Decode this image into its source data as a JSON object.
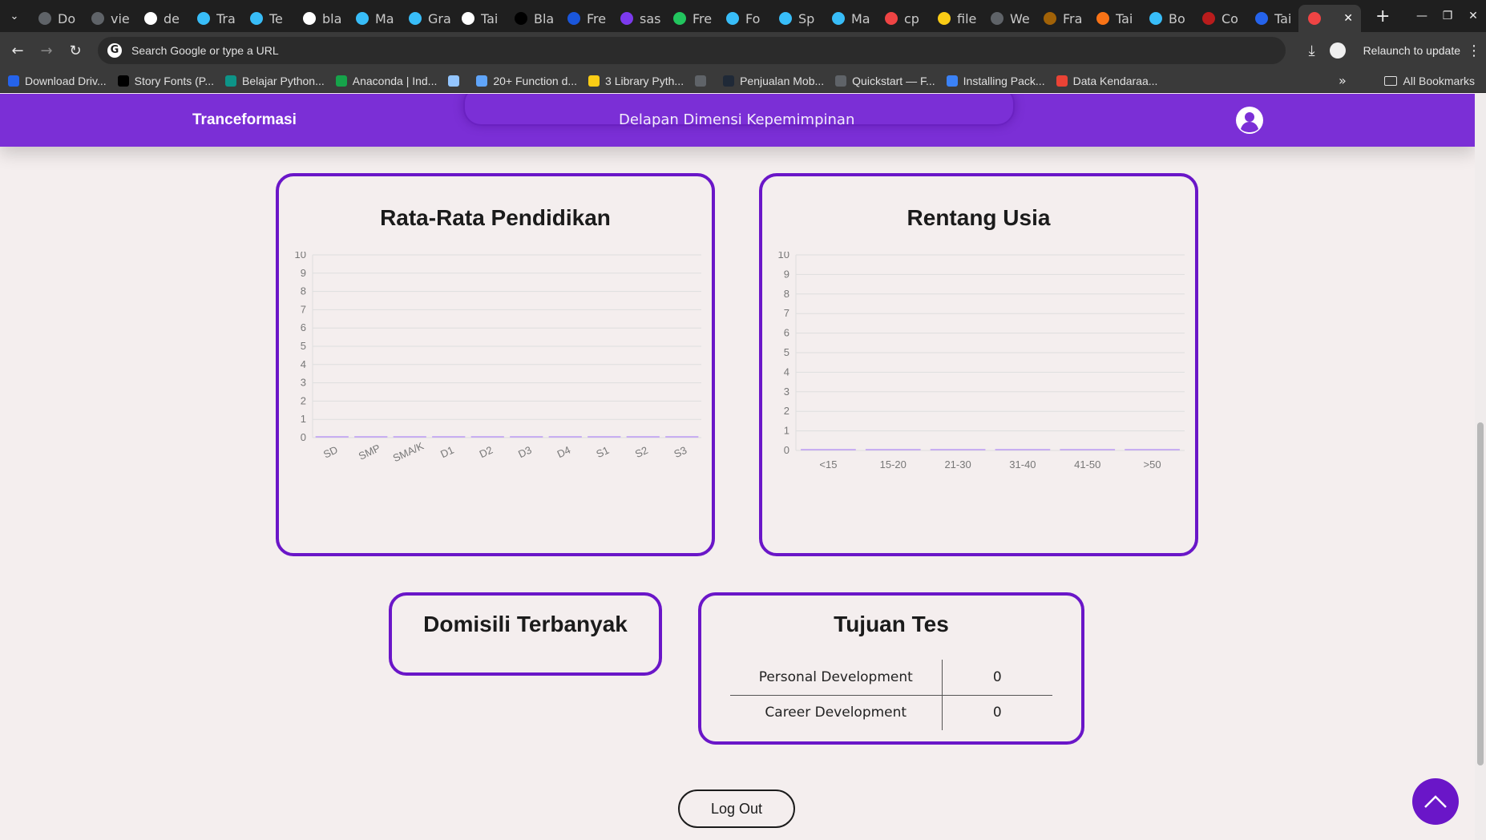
{
  "browser": {
    "tabs": [
      {
        "title": "Do",
        "icon": "globe-icon",
        "color": "#5f6368"
      },
      {
        "title": "vie",
        "icon": "globe-icon",
        "color": "#5f6368"
      },
      {
        "title": "de",
        "icon": "google-icon",
        "color": "#ffffff"
      },
      {
        "title": "Tra",
        "icon": "tailwind-icon",
        "color": "#38bdf8"
      },
      {
        "title": "Te",
        "icon": "tailwind-icon",
        "color": "#38bdf8"
      },
      {
        "title": "bla",
        "icon": "google-icon",
        "color": "#ffffff"
      },
      {
        "title": "Ma",
        "icon": "tailwind-icon",
        "color": "#38bdf8"
      },
      {
        "title": "Gra",
        "icon": "tailwind-icon",
        "color": "#38bdf8"
      },
      {
        "title": "Tai",
        "icon": "openai-icon",
        "color": "#ffffff"
      },
      {
        "title": "Bla",
        "icon": "github-icon",
        "color": "#000000"
      },
      {
        "title": "Fre",
        "icon": "flowbite-icon",
        "color": "#1a56db"
      },
      {
        "title": "sas",
        "icon": "sass-icon",
        "color": "#7c3aed"
      },
      {
        "title": "Fre",
        "icon": "android-icon",
        "color": "#22c55e"
      },
      {
        "title": "Fo",
        "icon": "tailwind-icon",
        "color": "#38bdf8"
      },
      {
        "title": "Sp",
        "icon": "tailwind-icon",
        "color": "#38bdf8"
      },
      {
        "title": "Ma",
        "icon": "tailwind-icon",
        "color": "#38bdf8"
      },
      {
        "title": "cp",
        "icon": "cp-icon",
        "color": "#ef4444"
      },
      {
        "title": "file",
        "icon": "shield-icon",
        "color": "#facc15"
      },
      {
        "title": "We",
        "icon": "globe-icon",
        "color": "#5f6368"
      },
      {
        "title": "Fra",
        "icon": "grad-cap-icon",
        "color": "#a16207"
      },
      {
        "title": "Tai",
        "icon": "fire-icon",
        "color": "#f97316"
      },
      {
        "title": "Bo",
        "icon": "tailwind-icon",
        "color": "#38bdf8"
      },
      {
        "title": "Co",
        "icon": "coin-icon",
        "color": "#b91c1c"
      },
      {
        "title": "Tai",
        "icon": "circle-icon",
        "color": "#2563eb"
      },
      {
        "title": "",
        "icon": "laravel-icon",
        "color": "#ef4444",
        "active": true
      }
    ],
    "new_tab": "+",
    "omnibox_placeholder": "Search Google or type a URL",
    "relaunch_label": "Relaunch to update",
    "bookmarks": [
      {
        "label": "Download Driv...",
        "color": "#2563eb"
      },
      {
        "label": "Story Fonts (P...",
        "color": "#000000"
      },
      {
        "label": "Belajar Python...",
        "color": "#0d9488"
      },
      {
        "label": "Anaconda | Ind...",
        "color": "#16a34a"
      },
      {
        "label": "",
        "color": "#93c5fd"
      },
      {
        "label": "20+ Function d...",
        "color": "#60a5fa"
      },
      {
        "label": "3 Library Pyth...",
        "color": "#facc15"
      },
      {
        "label": "",
        "color": "#5f6368"
      },
      {
        "label": "Penjualan Mob...",
        "color": "#1f2937"
      },
      {
        "label": "Quickstart — F...",
        "color": "#5f6368"
      },
      {
        "label": "Installing Pack...",
        "color": "#3b82f6"
      },
      {
        "label": "Data Kendaraa...",
        "color": "#ea4335"
      }
    ],
    "bookmarks_more": "»",
    "all_bookmarks": "All Bookmarks"
  },
  "navbar": {
    "brand": "Tranceformasi",
    "center_link": "Delapan Dimensi Kepemimpinan",
    "accent": "#7b2fd6"
  },
  "cards": {
    "pendidikan_title": "Rata-Rata Pendidikan",
    "usia_title": "Rentang Usia",
    "domisili_title": "Domisili Terbanyak",
    "tujuan_title": "Tujuan Tes",
    "tujuan_rows": [
      {
        "label": "Personal Development",
        "value": "0"
      },
      {
        "label": "Career Development",
        "value": "0"
      }
    ],
    "border_color": "#6a16c8"
  },
  "chart_data": [
    {
      "type": "bar",
      "title": "Rata-Rata Pendidikan",
      "categories": [
        "SD",
        "SMP",
        "SMA/K",
        "D1",
        "D2",
        "D3",
        "D4",
        "S1",
        "S2",
        "S3"
      ],
      "values": [
        0,
        0,
        0,
        0,
        0,
        0,
        0,
        0,
        0,
        0
      ],
      "ylim": [
        0,
        10
      ],
      "yticks": [
        0,
        1,
        2,
        3,
        4,
        5,
        6,
        7,
        8,
        9,
        10
      ],
      "grid": true,
      "bar_color": "#b794f4"
    },
    {
      "type": "bar",
      "title": "Rentang Usia",
      "categories": [
        "<15",
        "15-20",
        "21-30",
        "31-40",
        "41-50",
        ">50"
      ],
      "values": [
        0,
        0,
        0,
        0,
        0,
        0
      ],
      "ylim": [
        0,
        10
      ],
      "yticks": [
        0,
        1,
        2,
        3,
        4,
        5,
        6,
        7,
        8,
        9,
        10
      ],
      "grid": true,
      "bar_color": "#b794f4"
    }
  ],
  "logout_label": "Log Out"
}
